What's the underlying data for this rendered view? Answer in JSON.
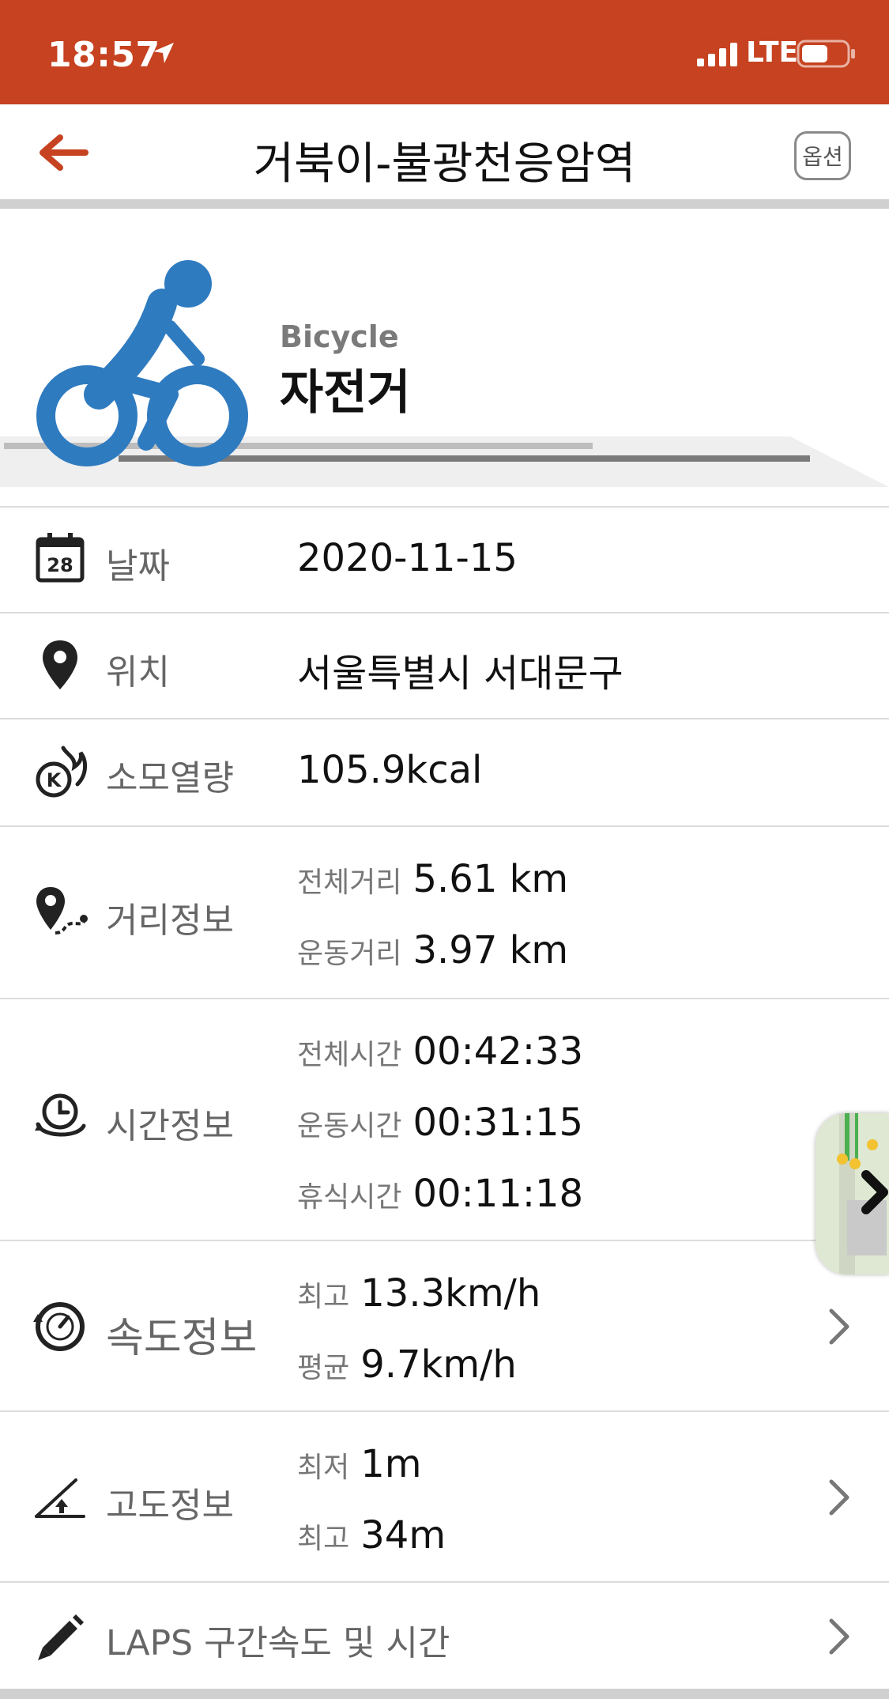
{
  "status_bar": {
    "time": "18:57",
    "network": "LTE",
    "location_icon": "location-arrow-icon",
    "signal_icon": "signal-bars-icon",
    "battery_icon": "battery-icon"
  },
  "header": {
    "title": "거북이-불광천응암역",
    "back_icon": "back-arrow-icon",
    "option_label": "옵션"
  },
  "activity": {
    "icon": "bicycle-icon",
    "name_en": "Bicycle",
    "name_ko": "자전거"
  },
  "rows": {
    "date": {
      "icon": "calendar-icon",
      "icon_text": "28",
      "label": "날짜",
      "value": "2020-11-15"
    },
    "location": {
      "icon": "location-pin-icon",
      "label": "위치",
      "value": "서울특별시 서대문구"
    },
    "calories": {
      "icon": "calorie-flame-icon",
      "icon_text": "K",
      "label": "소모열량",
      "value": "105.9kcal"
    },
    "distance": {
      "icon": "route-pin-icon",
      "label": "거리정보",
      "items": [
        {
          "label": "전체거리",
          "value": "5.61 km"
        },
        {
          "label": "운동거리",
          "value": "3.97 km"
        }
      ]
    },
    "time": {
      "icon": "clock-cycle-icon",
      "label": "시간정보",
      "items": [
        {
          "label": "전체시간",
          "value": "00:42:33"
        },
        {
          "label": "운동시간",
          "value": "00:31:15"
        },
        {
          "label": "휴식시간",
          "value": "00:11:18"
        }
      ]
    },
    "speed": {
      "icon": "speedometer-icon",
      "label": "속도정보",
      "items": [
        {
          "label": "최고",
          "value": "13.3km/h"
        },
        {
          "label": "평균",
          "value": "9.7km/h"
        }
      ]
    },
    "altitude": {
      "icon": "altitude-icon",
      "label": "고도정보",
      "items": [
        {
          "label": "최저",
          "value": "1m"
        },
        {
          "label": "최고",
          "value": "34m"
        }
      ]
    },
    "laps": {
      "icon": "pencil-icon",
      "label": "LAPS 구간속도 및 시간"
    }
  },
  "colors": {
    "status_bar": "#C64220",
    "accent": "#C64220",
    "bicycle": "#2F7BC0"
  }
}
